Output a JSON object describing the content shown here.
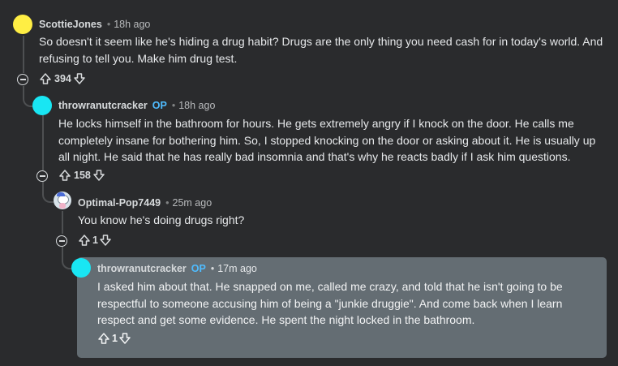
{
  "colors": {
    "background": "#2a2b2d",
    "highlight": "#646d73",
    "op_badge": "#4fbcff",
    "avatar_yellow": "#ffee44",
    "avatar_cyan": "#19e6f3"
  },
  "comments": [
    {
      "author": "ScottieJones",
      "time": "18h ago",
      "body": "So doesn't it seem like he's hiding a drug habit? Drugs are the only thing you need cash for in today's world. And refusing to tell you. Make him drug test.",
      "score": "394"
    },
    {
      "author": "throwranutcracker",
      "op": "OP",
      "time": "18h ago",
      "body": "He locks himself in the bathroom for hours. He gets extremely angry if I knock on the door. He calls me completely insane for bothering him. So, I stopped knocking on the door or asking about it. He is usually up all night. He said that he has really bad insomnia and that's why he reacts badly if I ask him questions.",
      "score": "158"
    },
    {
      "author": "Optimal-Pop7449",
      "time": "25m ago",
      "body": "You know he's doing drugs right?",
      "score": "1"
    },
    {
      "author": "throwranutcracker",
      "op": "OP",
      "time": "17m ago",
      "body": "I asked him about that. He snapped on me, called me crazy, and told that he isn't going to be respectful to someone accusing him of being a \"junkie druggie\". And come back when I learn respect and get some evidence. He spent the night locked in the bathroom.",
      "score": "1"
    }
  ],
  "icons": {
    "upvote": "arrow-up-icon",
    "downvote": "arrow-down-icon",
    "collapse": "collapse-thread-icon"
  }
}
